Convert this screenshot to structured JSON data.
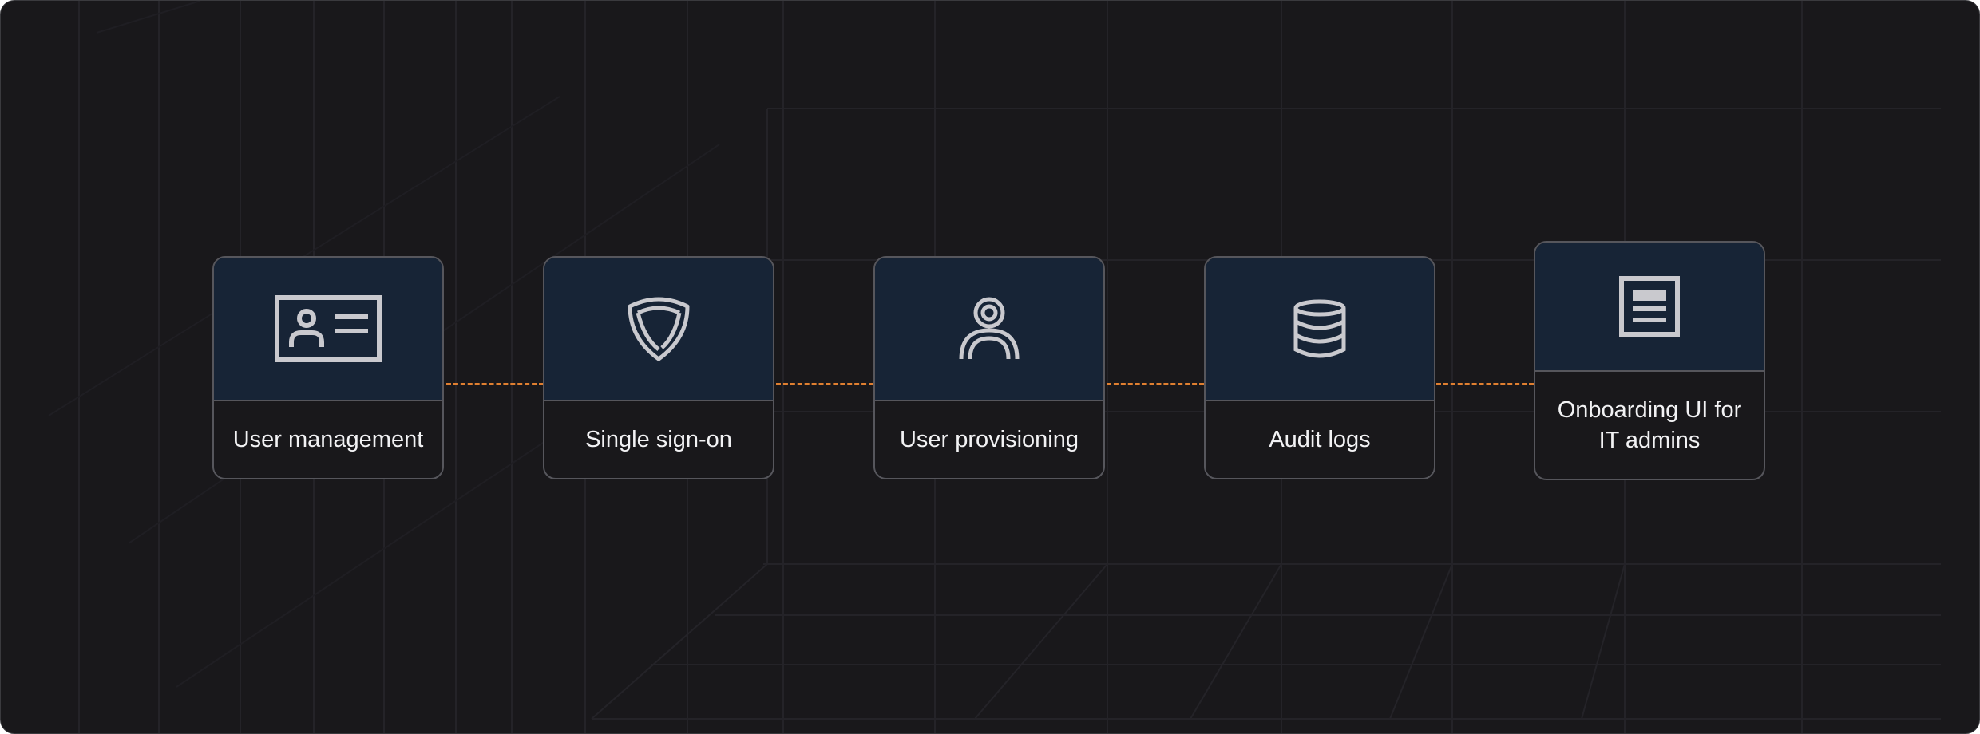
{
  "colors": {
    "background": "#19181b",
    "card_header": "#172436",
    "card_border": "#56565c",
    "connector": "#e07f30",
    "icon": "#c9c9ce",
    "text": "#f2f2f4"
  },
  "steps": [
    {
      "label": "User management",
      "icon": "id-card-icon"
    },
    {
      "label": "Single sign-on",
      "icon": "shield-icon"
    },
    {
      "label": "User provisioning",
      "icon": "user-icon"
    },
    {
      "label": "Audit logs",
      "icon": "database-icon"
    },
    {
      "label": "Onboarding UI for IT admins",
      "icon": "document-icon"
    }
  ]
}
